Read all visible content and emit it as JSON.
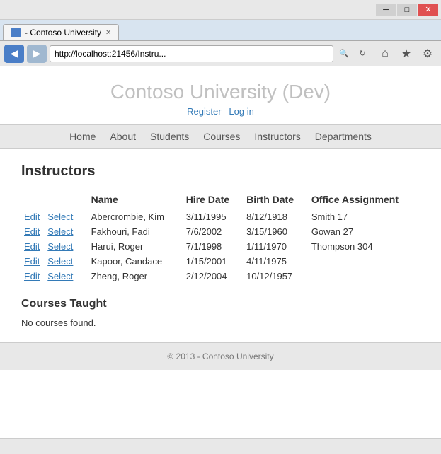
{
  "browser": {
    "url": "http://localhost:21456/Instru...",
    "tab_title": "- Contoso University",
    "back_icon": "◀",
    "forward_icon": "▶",
    "refresh_icon": "↻",
    "home_icon": "⌂",
    "star_icon": "★",
    "settings_icon": "⚙",
    "minimize_icon": "─",
    "maximize_icon": "□",
    "close_icon": "✕"
  },
  "site": {
    "title": "Contoso University (Dev)",
    "auth": {
      "register": "Register",
      "login": "Log in"
    },
    "nav": [
      "Home",
      "About",
      "Students",
      "Courses",
      "Instructors",
      "Departments"
    ]
  },
  "page": {
    "heading": "Instructors",
    "table": {
      "columns": [
        "",
        "Name",
        "Hire Date",
        "Birth Date",
        "Office Assignment"
      ],
      "rows": [
        {
          "edit": "Edit",
          "select": "Select",
          "name": "Abercrombie, Kim",
          "hire_date": "3/11/1995",
          "birth_date": "8/12/1918",
          "office": "Smith 17"
        },
        {
          "edit": "Edit",
          "select": "Select",
          "name": "Fakhouri, Fadi",
          "hire_date": "7/6/2002",
          "birth_date": "3/15/1960",
          "office": "Gowan 27"
        },
        {
          "edit": "Edit",
          "select": "Select",
          "name": "Harui, Roger",
          "hire_date": "7/1/1998",
          "birth_date": "1/11/1970",
          "office": "Thompson 304"
        },
        {
          "edit": "Edit",
          "select": "Select",
          "name": "Kapoor, Candace",
          "hire_date": "1/15/2001",
          "birth_date": "4/11/1975",
          "office": ""
        },
        {
          "edit": "Edit",
          "select": "Select",
          "name": "Zheng, Roger",
          "hire_date": "2/12/2004",
          "birth_date": "10/12/1957",
          "office": ""
        }
      ]
    },
    "courses_heading": "Courses Taught",
    "no_courses": "No courses found.",
    "footer": "© 2013 - Contoso University"
  }
}
